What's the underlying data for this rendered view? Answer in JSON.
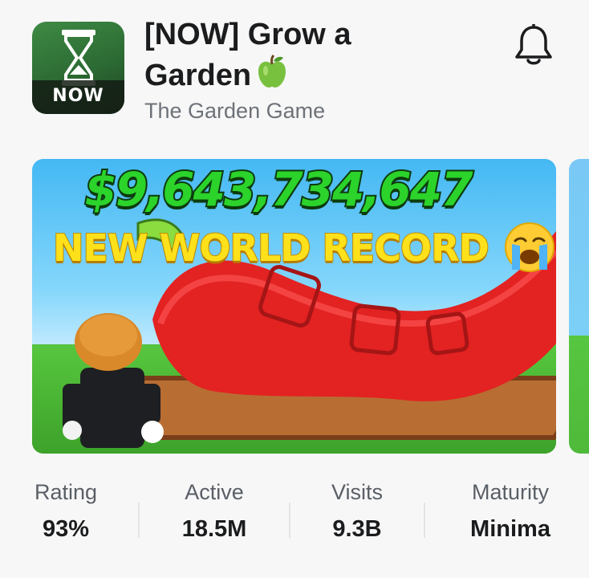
{
  "game": {
    "title_line1": "[NOW] Grow a",
    "title_line2": "Garden",
    "creator": "The Garden Game",
    "icon_badge": "NOW"
  },
  "icons": {
    "title_emoji": "green-apple-icon",
    "notify": "bell-icon"
  },
  "thumbnail": {
    "amount": "$9,643,734,647",
    "headline": "NEW WORLD RECORD",
    "emoji": "loudly-crying-face-icon"
  },
  "stats": [
    {
      "label": "Rating",
      "value": "93%"
    },
    {
      "label": "Active",
      "value": "18.5M"
    },
    {
      "label": "Visits",
      "value": "9.3B"
    },
    {
      "label": "Maturity",
      "value": "Minima"
    }
  ],
  "colors": {
    "background": "#f7f7f8",
    "title": "#1b1c1d",
    "secondary_text": "#6d7278",
    "amount_green": "#2bd32b",
    "headline_yellow": "#ffe11b"
  }
}
